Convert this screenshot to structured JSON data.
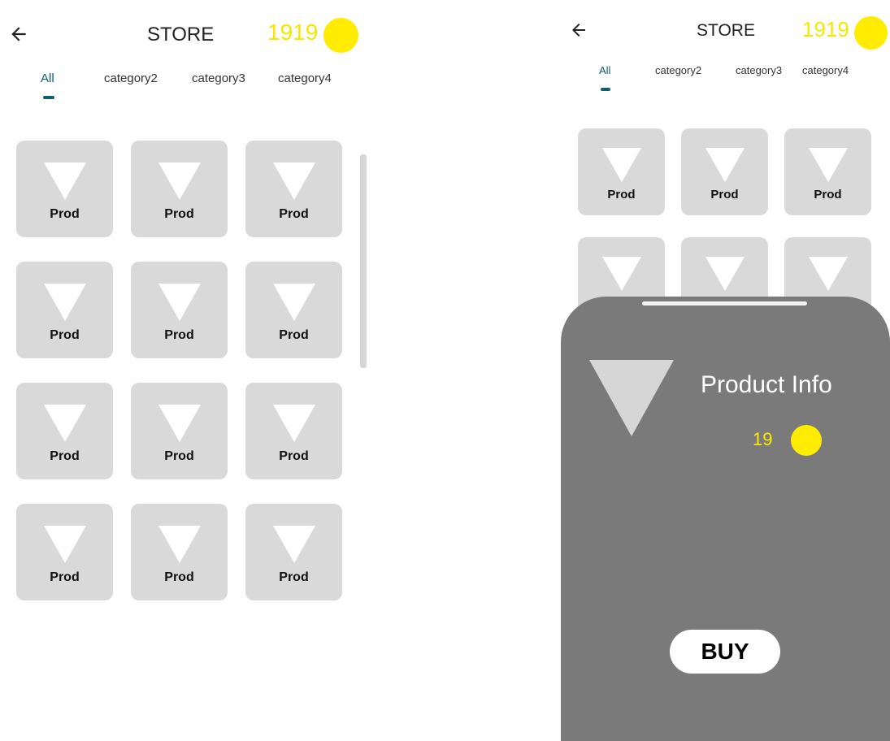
{
  "header": {
    "title": "STORE",
    "coins": "1919",
    "back_icon": "arrow-left-icon",
    "coin_icon": "coin-icon"
  },
  "tabs": [
    {
      "label": "All",
      "active": true
    },
    {
      "label": "category2",
      "active": false
    },
    {
      "label": "category3",
      "active": false
    },
    {
      "label": "category4",
      "active": false
    }
  ],
  "products": [
    {
      "label": "Prod",
      "icon": "triangle-down-icon"
    },
    {
      "label": "Prod",
      "icon": "triangle-down-icon"
    },
    {
      "label": "Prod",
      "icon": "triangle-down-icon"
    },
    {
      "label": "Prod",
      "icon": "triangle-down-icon"
    },
    {
      "label": "Prod",
      "icon": "triangle-down-icon"
    },
    {
      "label": "Prod",
      "icon": "triangle-down-icon"
    },
    {
      "label": "Prod",
      "icon": "triangle-down-icon"
    },
    {
      "label": "Prod",
      "icon": "triangle-down-icon"
    },
    {
      "label": "Prod",
      "icon": "triangle-down-icon"
    },
    {
      "label": "Prod",
      "icon": "triangle-down-icon"
    },
    {
      "label": "Prod",
      "icon": "triangle-down-icon"
    },
    {
      "label": "Prod",
      "icon": "triangle-down-icon"
    }
  ],
  "product_sheet": {
    "title": "Product Info",
    "price": "19",
    "buy_label": "BUY",
    "image_icon": "triangle-down-icon"
  },
  "colors": {
    "accent": "#0f5f6a",
    "coin": "#ffec00",
    "card": "#d9d9d9",
    "sheet": "#7a7a7a"
  }
}
